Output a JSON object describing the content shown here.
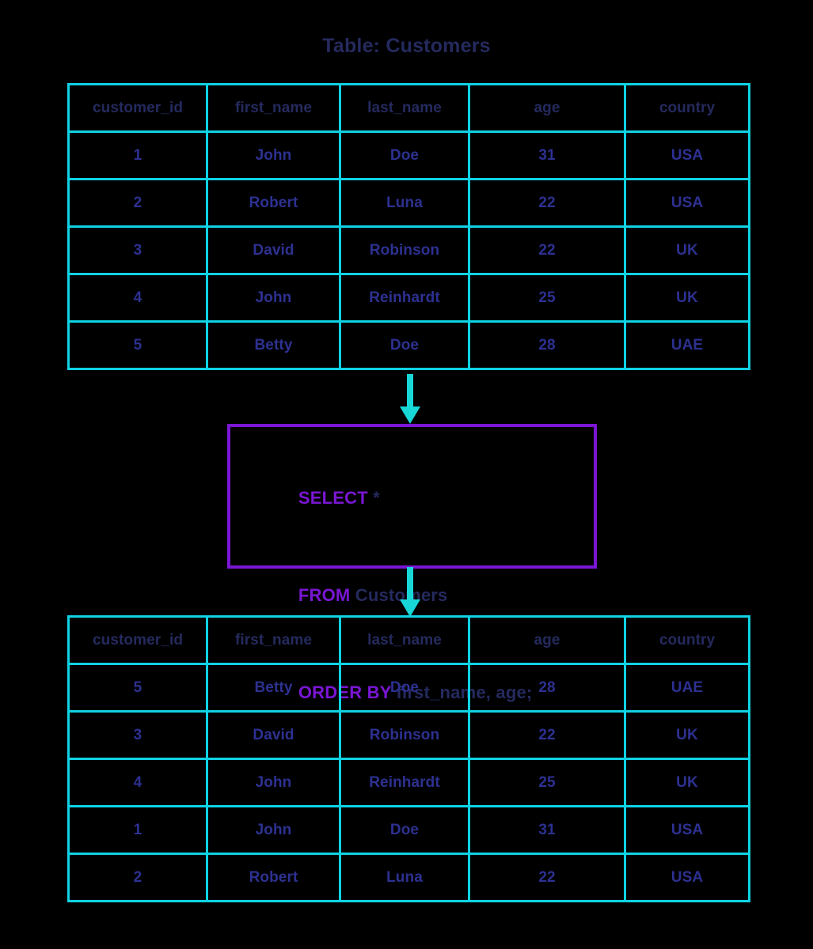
{
  "title": "Table: Customers",
  "colors": {
    "table_border": "#0fd2e4",
    "arrow": "#17d7d7",
    "sql_box_border": "#7a16d4",
    "sql_keyword": "#7a16d4",
    "header_text": "#252a5e",
    "cell_text": "#2d3191",
    "background": "#000000"
  },
  "columns": [
    "customer_id",
    "first_name",
    "last_name",
    "age",
    "country"
  ],
  "source_table": {
    "name": "Customers",
    "headers": [
      "customer_id",
      "first_name",
      "last_name",
      "age",
      "country"
    ],
    "rows": [
      [
        "1",
        "John",
        "Doe",
        "31",
        "USA"
      ],
      [
        "2",
        "Robert",
        "Luna",
        "22",
        "USA"
      ],
      [
        "3",
        "David",
        "Robinson",
        "22",
        "UK"
      ],
      [
        "4",
        "John",
        "Reinhardt",
        "25",
        "UK"
      ],
      [
        "5",
        "Betty",
        "Doe",
        "28",
        "UAE"
      ]
    ]
  },
  "query": {
    "lines": [
      {
        "keyword": "SELECT",
        "rest": " *"
      },
      {
        "keyword": "FROM",
        "rest": " Customers"
      },
      {
        "keyword": "ORDER BY",
        "rest": " first_name, age;"
      }
    ],
    "full_text": "SELECT *\nFROM Customers\nORDER BY first_name, age;"
  },
  "result_table": {
    "headers": [
      "customer_id",
      "first_name",
      "last_name",
      "age",
      "country"
    ],
    "rows": [
      [
        "5",
        "Betty",
        "Doe",
        "28",
        "UAE"
      ],
      [
        "3",
        "David",
        "Robinson",
        "22",
        "UK"
      ],
      [
        "4",
        "John",
        "Reinhardt",
        "25",
        "UK"
      ],
      [
        "1",
        "John",
        "Doe",
        "31",
        "USA"
      ],
      [
        "2",
        "Robert",
        "Luna",
        "22",
        "USA"
      ]
    ]
  },
  "arrows": {
    "top": "down-arrow",
    "bottom": "down-arrow"
  }
}
